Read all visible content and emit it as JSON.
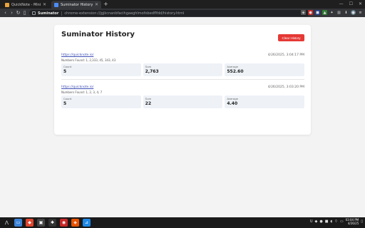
{
  "browser": {
    "tabs": [
      {
        "title": "QuickNote - Minimalist, Free Online No",
        "favicon_color": "#e8a33d",
        "active": false
      },
      {
        "title": "Suminator History",
        "favicon_color": "#4d8cf5",
        "active": true
      }
    ],
    "new_tab_label": "+",
    "omnibox": {
      "site_label": "Suminator",
      "url": "chrome-extension://jgjkcnanbfacihgaeghlmofobedflfdd/history.html"
    },
    "window_controls": {
      "minimize": "—",
      "maximize": "☐",
      "close": "✕"
    }
  },
  "page": {
    "title": "Suminator History",
    "clear_button_label": "Clear History",
    "entries": [
      {
        "link": "https://quicknote.io/",
        "date": "4/26/2025, 3:04:17 PM",
        "numbers_label": "Numbers Found: 1, 2,333, 45, 343, 43",
        "stats": [
          {
            "label": "Count",
            "value": "5"
          },
          {
            "label": "Sum",
            "value": "2,763"
          },
          {
            "label": "Average",
            "value": "552.60"
          }
        ]
      },
      {
        "link": "https://quicknote.io/",
        "date": "4/26/2025, 3:03:20 PM",
        "numbers_label": "Numbers Found: 1, 2, 3, 4, 7",
        "stats": [
          {
            "label": "Count",
            "value": "5"
          },
          {
            "label": "Sum",
            "value": "22"
          },
          {
            "label": "Average",
            "value": "4.40"
          }
        ]
      }
    ]
  },
  "taskbar": {
    "apps": [
      {
        "name": "arch-menu-icon",
        "color": "#1a1a1a",
        "glyph": "⋀"
      },
      {
        "name": "file-manager-icon",
        "color": "#3b83d8",
        "glyph": "▭"
      },
      {
        "name": "brave-browser-icon",
        "color": "#e0462f",
        "glyph": "◆"
      },
      {
        "name": "terminal-icon",
        "color": "#444444",
        "glyph": "▣"
      },
      {
        "name": "settings-icon",
        "color": "#333333",
        "glyph": "✱"
      },
      {
        "name": "red-app-icon",
        "color": "#c62828",
        "glyph": "◉"
      },
      {
        "name": "orange-app-icon",
        "color": "#e65100",
        "glyph": "◈"
      },
      {
        "name": "vscode-icon",
        "color": "#1e88e5",
        "glyph": "⊿"
      }
    ],
    "clock": {
      "time": "03:04 PM",
      "date": "4/26/25"
    }
  }
}
